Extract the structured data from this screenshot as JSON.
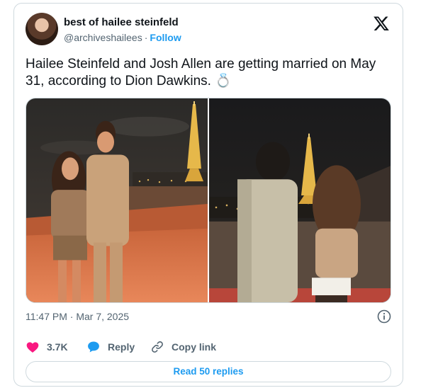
{
  "tweet": {
    "author_name": "best of hailee steinfeld",
    "author_handle": "@archiveshailees",
    "separator": "·",
    "follow_label": "Follow",
    "text": "Hailee Steinfeld and Josh Allen are getting married on May 31, according to Dion Dawkins. 💍",
    "timestamp": "11:47 PM · Mar 7, 2025",
    "icons": {
      "platform": "x-logo-icon",
      "info": "info-icon",
      "like": "heart-icon",
      "reply": "reply-bubble-icon",
      "copy": "link-icon"
    }
  },
  "actions": {
    "like_count": "3.7K",
    "reply_label": "Reply",
    "copy_label": "Copy link"
  },
  "footer": {
    "read_replies_label": "Read 50 replies"
  },
  "colors": {
    "accent": "#1d9bf0",
    "like": "#f91880",
    "muted": "#536471",
    "border": "#cfd9de"
  }
}
